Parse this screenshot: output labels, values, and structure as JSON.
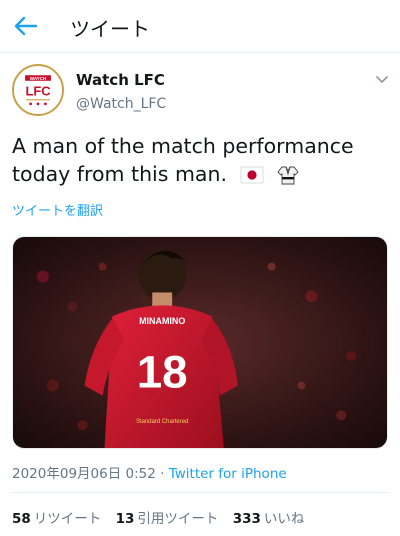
{
  "header": {
    "title": "ツイート",
    "back_icon": "arrow-left-icon",
    "accent": "#1da1f2"
  },
  "tweet": {
    "author_name": "Watch LFC",
    "author_handle": "@Watch_LFC",
    "avatar_text": "WATCH",
    "avatar_logo": "LFC",
    "text": "A man of the match performance today from this man.",
    "emojis": [
      "japan-flag-icon",
      "martial-arts-uniform-icon"
    ],
    "translate_label": "ツイートを翻訳",
    "media": {
      "jersey_name": "MINAMINO",
      "jersey_number": "18",
      "sponsor": "Standard Chartered"
    },
    "date": "2020年09月06日 0:52",
    "separator": "·",
    "source": "Twitter for iPhone"
  },
  "stats": {
    "retweets_count": "58",
    "retweets_label": "リツイート",
    "quotes_count": "13",
    "quotes_label": "引用ツイート",
    "likes_count": "333",
    "likes_label": "いいね"
  }
}
